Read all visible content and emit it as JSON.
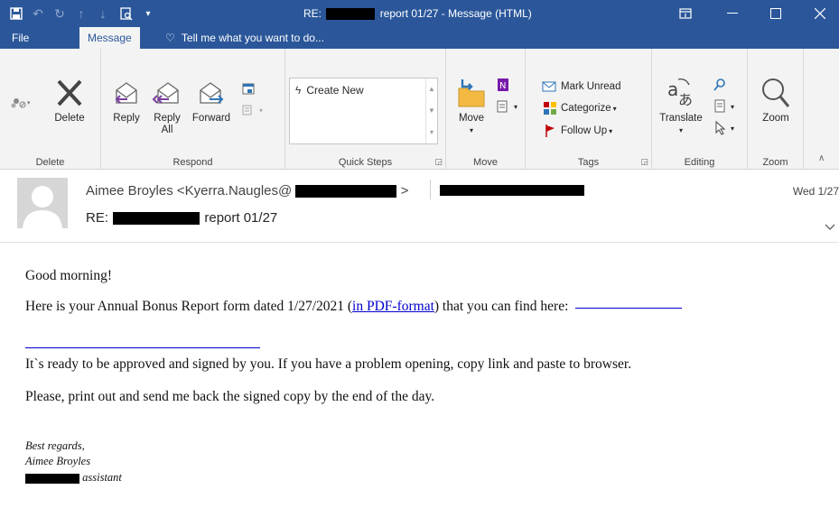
{
  "window": {
    "title_prefix": "RE:",
    "title_suffix": "report 01/27 - Message (HTML)"
  },
  "ribbon_tabs": {
    "file": "File",
    "message": "Message",
    "tell_me": "Tell me what you want to do..."
  },
  "ribbon": {
    "delete_group": {
      "delete": "Delete",
      "label": "Delete"
    },
    "respond_group": {
      "reply": "Reply",
      "reply_all_1": "Reply",
      "reply_all_2": "All",
      "forward": "Forward",
      "label": "Respond"
    },
    "quick_steps": {
      "create_new": "Create New",
      "label": "Quick Steps"
    },
    "move_group": {
      "move": "Move",
      "label": "Move"
    },
    "tags_group": {
      "mark_unread": "Mark Unread",
      "categorize": "Categorize",
      "follow_up": "Follow Up",
      "label": "Tags"
    },
    "editing_group": {
      "translate": "Translate",
      "label": "Editing"
    },
    "zoom_group": {
      "zoom": "Zoom",
      "label": "Zoom"
    }
  },
  "message": {
    "sender_name": "Aimee Broyles <Kyerra.Naugles@",
    "sender_close": ">",
    "date": "Wed 1/27",
    "subject_prefix": "RE:",
    "subject_suffix": "report 01/27"
  },
  "body": {
    "greeting": "Good morning!",
    "line1_pre": "Here is your Annual Bonus Report form dated 1/27/2021 (",
    "line1_link": "in PDF-format",
    "line1_post": ") that you can find here:",
    "line2": "It`s ready to be approved and signed by you. If you have a problem opening, copy link and paste to browser.",
    "line3": "Please, print out and send me back the signed copy by the end of the day.",
    "sig1": "Best regards,",
    "sig2": "Aimee Broyles",
    "sig3": "assistant"
  },
  "colors": {
    "accent": "#2b579a",
    "link": "#0000cc",
    "ribbon_bg": "#f3f3f3"
  }
}
